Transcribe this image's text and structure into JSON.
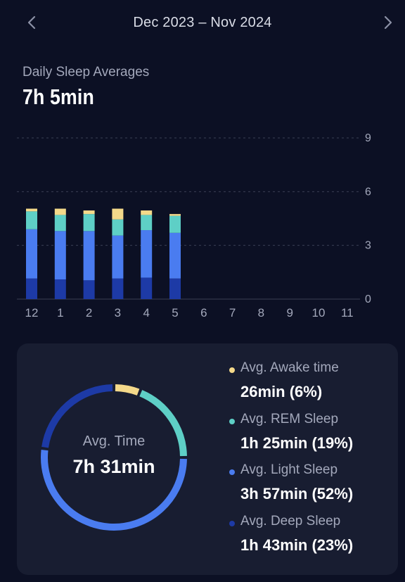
{
  "header": {
    "date_range": "Dec 2023 – Nov 2024",
    "prev_icon": "chevron-left-icon",
    "next_icon": "chevron-right-icon"
  },
  "summary": {
    "label": "Daily Sleep Averages",
    "value": "7h 5min"
  },
  "colors": {
    "background": "#0c1024",
    "card": "#181d31",
    "awake": "#f4d98a",
    "rem": "#5ecfc6",
    "light": "#4a7cf0",
    "deep": "#1d3aa6",
    "grid": "#3a3f55",
    "text_muted": "#a3a8bb"
  },
  "chart_data": {
    "type": "bar",
    "stacked": true,
    "categories": [
      "12",
      "1",
      "2",
      "3",
      "4",
      "5",
      "6",
      "7",
      "8",
      "9",
      "10",
      "11"
    ],
    "series": [
      {
        "key": "deep",
        "values": [
          1.15,
          1.1,
          1.05,
          1.15,
          1.2,
          1.15,
          0,
          0,
          0,
          0,
          0,
          0
        ]
      },
      {
        "key": "light",
        "values": [
          2.75,
          2.7,
          2.75,
          2.4,
          2.65,
          2.55,
          0,
          0,
          0,
          0,
          0,
          0
        ]
      },
      {
        "key": "rem",
        "values": [
          1.0,
          0.9,
          0.95,
          0.9,
          0.85,
          0.95,
          0,
          0,
          0,
          0,
          0,
          0
        ]
      },
      {
        "key": "awake",
        "values": [
          0.15,
          0.35,
          0.2,
          0.6,
          0.25,
          0.1,
          0,
          0,
          0,
          0,
          0,
          0
        ]
      }
    ],
    "ylim": [
      0,
      9
    ],
    "yticks": [
      "0",
      "3",
      "6",
      "9"
    ],
    "grid": true
  },
  "breakdown": {
    "center_label": "Avg. Time",
    "center_value": "7h 31min",
    "items": [
      {
        "key": "awake",
        "label": "Avg. Awake time",
        "value": "26min  (6%)",
        "percent": 6
      },
      {
        "key": "rem",
        "label": "Avg. REM Sleep",
        "value": "1h 25min  (19%)",
        "percent": 19
      },
      {
        "key": "light",
        "label": "Avg. Light Sleep",
        "value": "3h 57min  (52%)",
        "percent": 52
      },
      {
        "key": "deep",
        "label": "Avg. Deep Sleep",
        "value": "1h 43min  (23%)",
        "percent": 23
      }
    ]
  }
}
